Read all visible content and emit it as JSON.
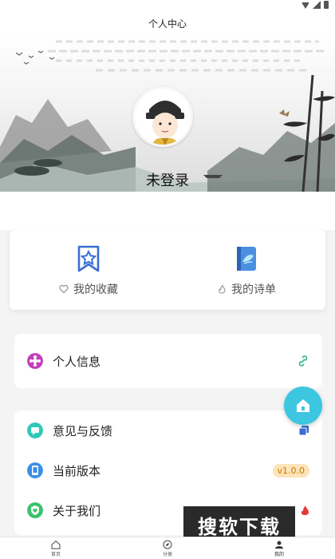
{
  "header": {
    "title": "个人中心"
  },
  "profile": {
    "login_text": "未登录"
  },
  "favorites": [
    {
      "label": "我的收藏",
      "icon": "bookmark-star-icon"
    },
    {
      "label": "我的诗单",
      "icon": "poetry-book-icon"
    }
  ],
  "settings": {
    "personal_info": "个人信息",
    "feedback": "意见与反馈",
    "version_label": "当前版本",
    "version_value": "v1.0.0",
    "about": "关于我们"
  },
  "watermark": "搜软下载",
  "nav": [
    {
      "label": "首页",
      "icon": "home-icon"
    },
    {
      "label": "分类",
      "icon": "compass-icon"
    },
    {
      "label": "我的",
      "icon": "profile-icon"
    }
  ],
  "colors": {
    "accent": "#3dc6e0",
    "primary_blue": "#3a6ed6",
    "badge_bg": "#fde3b8"
  }
}
